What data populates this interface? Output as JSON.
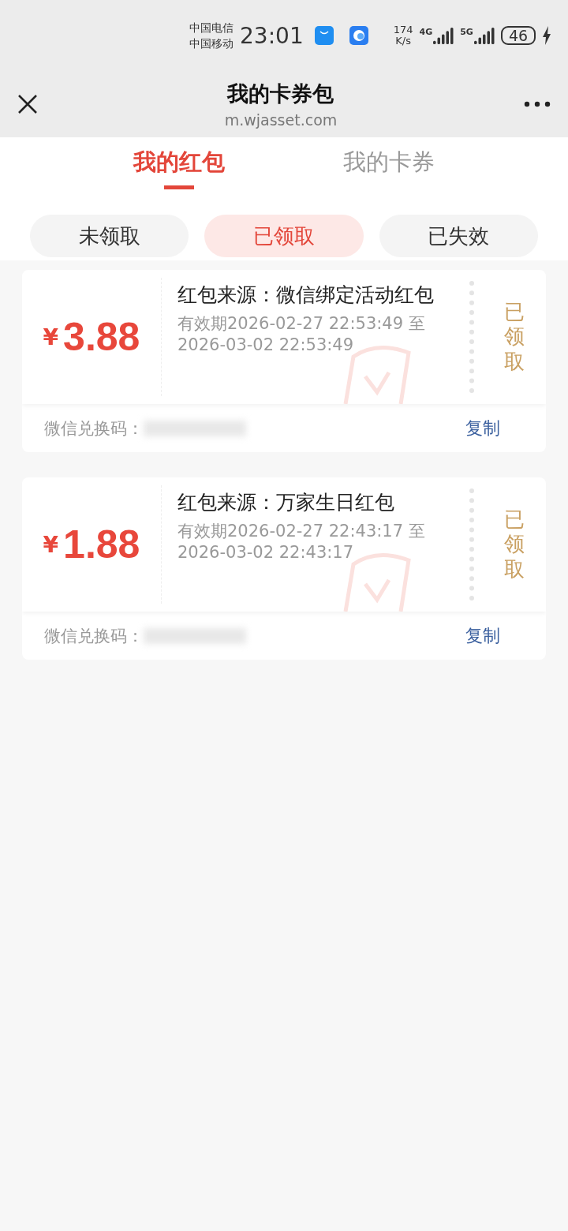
{
  "status_bar": {
    "carriers": [
      "中国电信",
      "中国移动"
    ],
    "time": "23:01",
    "speed_value": "174",
    "speed_unit": "K/s",
    "signals": [
      {
        "label": "4G"
      },
      {
        "label": "5G"
      }
    ],
    "battery": "46",
    "charging": true
  },
  "header": {
    "title": "我的卡券包",
    "subtitle": "m.wjasset.com"
  },
  "tabs": [
    {
      "label": "我的红包",
      "selected": true
    },
    {
      "label": "我的卡券",
      "selected": false
    }
  ],
  "filters": [
    {
      "label": "未领取",
      "selected": false
    },
    {
      "label": "已领取",
      "selected": true
    },
    {
      "label": "已失效",
      "selected": false
    }
  ],
  "coupons": [
    {
      "currency": "¥",
      "amount": "3.88",
      "source": "红包来源：微信绑定活动红包",
      "validity": "有效期2026-02-27 22:53:49 至 2026-03-02 22:53:49",
      "status": "已领取",
      "code_label": "微信兑换码：",
      "action": "复制"
    },
    {
      "currency": "¥",
      "amount": "1.88",
      "source": "红包来源：万家生日红包",
      "validity": "有效期2026-02-27 22:43:17 至 2026-03-02 22:43:17",
      "status": "已领取",
      "code_label": "微信兑换码：",
      "action": "复制"
    }
  ]
}
